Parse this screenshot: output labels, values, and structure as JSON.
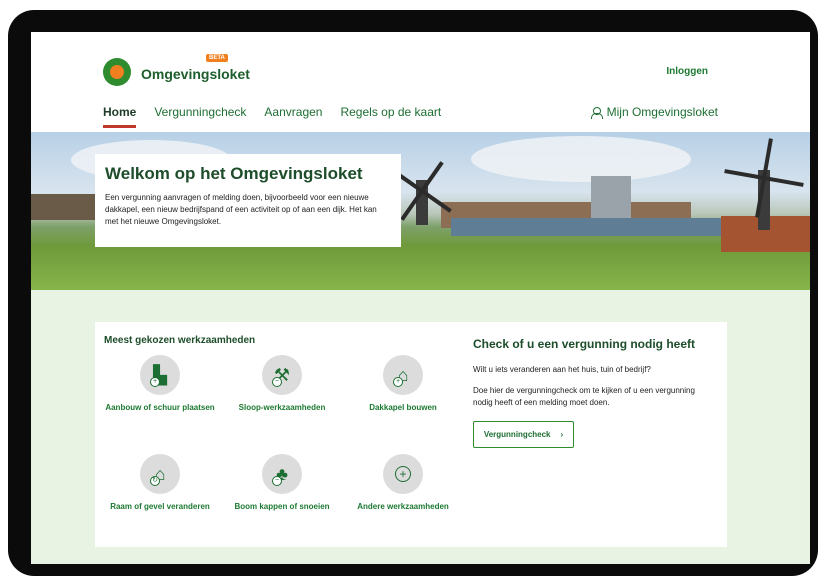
{
  "header": {
    "logo_text": "Omgevingsloket",
    "beta_label": "BETA",
    "login_label": "Inloggen",
    "nav": [
      {
        "label": "Home",
        "active": true
      },
      {
        "label": "Vergunningcheck",
        "active": false
      },
      {
        "label": "Aanvragen",
        "active": false
      },
      {
        "label": "Regels op de kaart",
        "active": false
      }
    ],
    "mijn_label": "Mijn Omgevingsloket",
    "mijn_icon": "person-icon"
  },
  "hero": {
    "title": "Welkom op het Omgevingsloket",
    "text": "Een vergunning aanvragen of melding doen, bijvoorbeeld voor een nieuwe dakkapel, een nieuw bedrijfspand of een activiteit op of aan een dijk. Het kan met het nieuwe Omgevingsloket."
  },
  "werkzaamheden": {
    "title": "Meest gekozen werkzaamheden",
    "items": [
      {
        "label": "Aanbouw of schuur plaatsen",
        "icon": "shed-icon"
      },
      {
        "label": "Sloop-werkzaamheden",
        "icon": "crane-icon"
      },
      {
        "label": "Dakkapel bouwen",
        "icon": "house-icon"
      },
      {
        "label": "Raam of gevel veranderen",
        "icon": "window-icon"
      },
      {
        "label": "Boom kappen of snoeien",
        "icon": "tree-icon"
      },
      {
        "label": "Andere werkzaamheden",
        "icon": "plus-icon"
      }
    ]
  },
  "check": {
    "title": "Check of u een vergunning nodig heeft",
    "p1": "Wilt u iets veranderen aan het huis, tuin of bedrijf?",
    "p2": "Doe hier de vergunningcheck om te kijken of u een vergunning nodig heeft of een melding moet doen.",
    "button_label": "Vergunningcheck",
    "button_icon": "chevron-right-icon"
  },
  "colors": {
    "brand_green": "#1d6e32",
    "accent_orange": "#f07f1f",
    "active_underline": "#c0392b",
    "section_bg": "#e8f3e4"
  }
}
